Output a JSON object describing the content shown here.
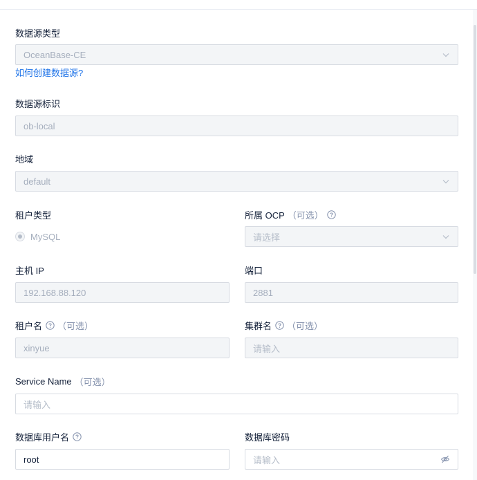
{
  "datasource_type": {
    "label": "数据源类型",
    "value": "OceanBase-CE",
    "help_link": "如何创建数据源?"
  },
  "datasource_id": {
    "label": "数据源标识",
    "value": "ob-local"
  },
  "region": {
    "label": "地域",
    "value": "default"
  },
  "tenant_type": {
    "label": "租户类型",
    "option": "MySQL"
  },
  "ocp": {
    "label": "所属 OCP",
    "optional": "（可选）",
    "placeholder": "请选择"
  },
  "host_ip": {
    "label": "主机 IP",
    "value": "192.168.88.120"
  },
  "port": {
    "label": "端口",
    "value": "2881"
  },
  "tenant_name": {
    "label": "租户名",
    "optional": "（可选）",
    "value": "xinyue"
  },
  "cluster_name": {
    "label": "集群名",
    "optional": "（可选）",
    "placeholder": "请输入"
  },
  "service_name": {
    "label": "Service Name",
    "optional": "（可选）",
    "placeholder": "请输入"
  },
  "db_user": {
    "label": "数据库用户名",
    "value": "root"
  },
  "db_password": {
    "label": "数据库密码",
    "placeholder": "请输入"
  },
  "icons": {
    "help": "question-circle-icon",
    "select_arrow": "chevron-down-icon",
    "password_toggle": "eye-invisible-icon"
  },
  "colors": {
    "link": "#1c72e8",
    "disabled_bg": "#f3f5f7",
    "border": "#d7dbe2"
  }
}
